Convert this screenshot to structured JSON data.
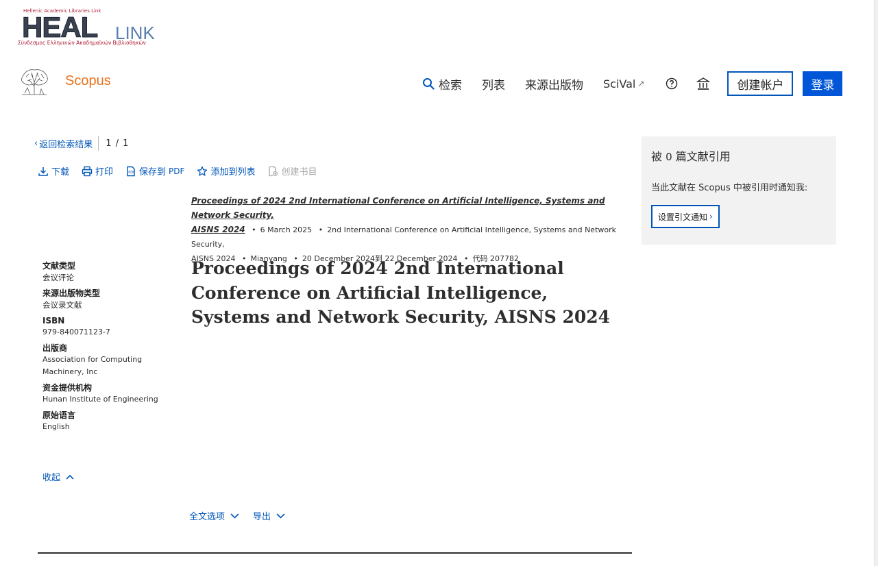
{
  "institution": {
    "tagline_top": "Hellenic Academic Libraries Link",
    "name_main": "HEAL",
    "name_suffix": "LINK",
    "tagline_bottom": "Σύνδεσμος Ελληνικών Ακαδημαϊκών Βιβλιοθηκών"
  },
  "header": {
    "brand": "Scopus",
    "nav": {
      "search": "检索",
      "lists": "列表",
      "sources": "来源出版物",
      "scival": "SciVal",
      "scival_ext": "↗"
    },
    "create_account": "创建帐户",
    "login": "登录"
  },
  "backbar": {
    "back_label": "返回检索结果",
    "pager": "1 / 1"
  },
  "toolbar": {
    "download": "下载",
    "print": "打印",
    "save_pdf": "保存到",
    "save_pdf_suffix": "PDF",
    "add_to_list": "添加到列表",
    "create_bib": "创建书目"
  },
  "source": {
    "title_line1": "Proceedings of 2024 2nd International Conference on Artificial Intelligence, Systems and Network Security,",
    "title_line2": "AISNS 2024",
    "date": "6 March 2025",
    "conference": "2nd International Conference on Artificial Intelligence, Systems and Network Security,",
    "conference_short": "AISNS 2024",
    "location": "Mianyang",
    "period": "20 December 2024到 22 December 2024",
    "code": "代码 207782"
  },
  "document": {
    "title": "Proceedings of 2024 2nd International Conference on Artificial Intelligence, Systems and Network Security, AISNS 2024"
  },
  "meta": {
    "doc_type_label": "文献类型",
    "doc_type": "会议评论",
    "source_type_label": "来源出版物类型",
    "source_type": "会议录文献",
    "isbn_label": "ISBN",
    "isbn": "979-840071123-7",
    "publisher_label": "出版商",
    "publisher": "Association for Computing Machinery, Inc",
    "funding_label": "资金提供机构",
    "funding": "Hunan Institute of Engineering",
    "language_label": "原始语言",
    "language": "English",
    "collapse": "收起"
  },
  "options": {
    "full_text": "全文选项",
    "export": "导出"
  },
  "citations": {
    "prefix": "被",
    "count": "0",
    "suffix": "篇文献引用",
    "notify_text": "当此文献在 Scopus 中被引用时通知我:",
    "alert_button": "设置引文通知",
    "alert_chevron": "›"
  },
  "colors": {
    "brand_orange": "#e9711c",
    "link_blue": "#0056b8",
    "primary_blue": "#0056d6",
    "panel_gray": "#f2f2f2"
  }
}
